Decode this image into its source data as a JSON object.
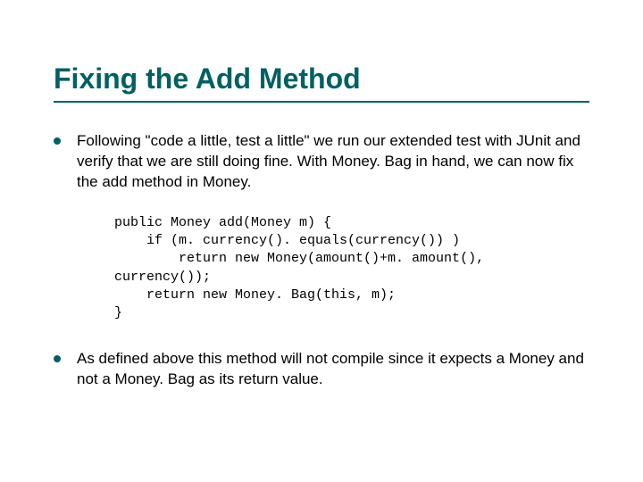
{
  "title": "Fixing the Add Method",
  "bullets": {
    "b1": "Following \"code a little, test a little\" we run our extended test with JUnit and verify that we are still doing fine. With Money. Bag in hand, we can now fix the add method in Money.",
    "b2": "As defined above this method will not compile since it expects a Money and not a Money. Bag as its return value."
  },
  "code": "public Money add(Money m) {\n    if (m. currency(). equals(currency()) )\n        return new Money(amount()+m. amount(),\ncurrency());\n    return new Money. Bag(this, m);\n}"
}
